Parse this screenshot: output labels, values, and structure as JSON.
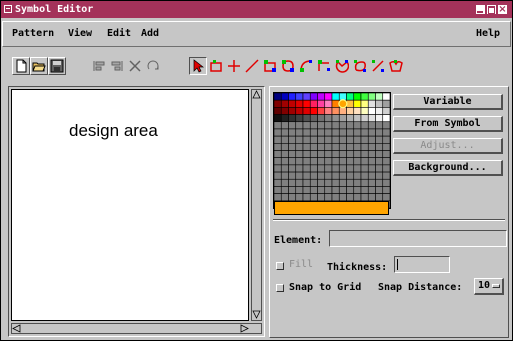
{
  "window": {
    "title": "Symbol Editor"
  },
  "menu": {
    "items": [
      "Pattern",
      "View",
      "Edit",
      "Add"
    ],
    "help": "Help"
  },
  "toolbar": {
    "tools": [
      "new-file-icon",
      "open-file-icon",
      "save-icon",
      "align-left-icon",
      "align-right-icon",
      "cross-box-icon",
      "rotate-icon",
      "select-arrow-icon",
      "rectangle-point-icon",
      "crosshair-point-icon",
      "line-icon",
      "polyline-icon",
      "polygon-icon",
      "arc-icon",
      "chord-icon",
      "pie-icon",
      "ellipse-icon",
      "text-line-icon",
      "spline-icon"
    ]
  },
  "design": {
    "label": "design area"
  },
  "palette": {
    "selected_color": "#ffa500",
    "buttons": {
      "variable": "Variable",
      "from_symbol": "From Symbol",
      "adjust": "Adjust...",
      "background": "Background..."
    }
  },
  "element": {
    "label": "Element:",
    "value": ""
  },
  "fill": {
    "label": "Fill",
    "checked": false
  },
  "thickness": {
    "label": "Thickness:",
    "value": ""
  },
  "snap": {
    "grid_label": "Snap to Grid",
    "grid_checked": false,
    "distance_label": "Snap Distance:",
    "distance_value": "10"
  },
  "colors": {
    "title_bar": "#a4325a",
    "window_bg": "#c6c6c6",
    "current_color": "#ffa500"
  }
}
